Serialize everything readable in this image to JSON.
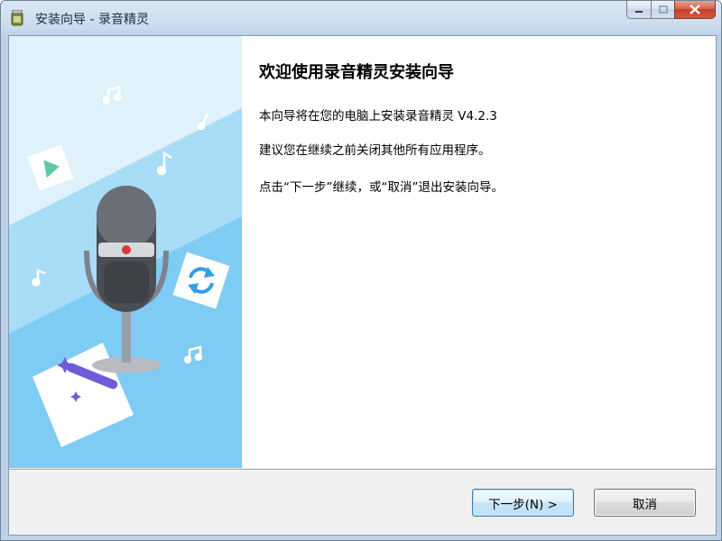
{
  "window": {
    "title": "安装向导 - 录音精灵",
    "icon": "installer-jar-icon",
    "caption_buttons": [
      "minimize-icon",
      "maximize-icon",
      "close-icon"
    ]
  },
  "banner": {
    "illustration": "microphone-illustration",
    "icons": [
      "music-note-icon",
      "play-triangle-icon",
      "refresh-arrows-icon",
      "magic-wand-icon"
    ]
  },
  "content": {
    "heading": "欢迎使用录音精灵安装向导",
    "paragraphs": [
      "本向导将在您的电脑上安装录音精灵 V4.2.3",
      "建议您在继续之前关闭其他所有应用程序。",
      "点击“下一步”继续，或“取消”退出安装向导。"
    ]
  },
  "buttons": {
    "next_label": "下一步(N) >",
    "cancel_label": "取消"
  },
  "colors": {
    "banner_light": "#d6eefa",
    "banner_stripe": "#7fcdf5",
    "mic_red": "#d93838",
    "accent_purple": "#6f5bd8",
    "accent_green": "#5dc9a4",
    "accent_blue": "#2f9ee6"
  }
}
